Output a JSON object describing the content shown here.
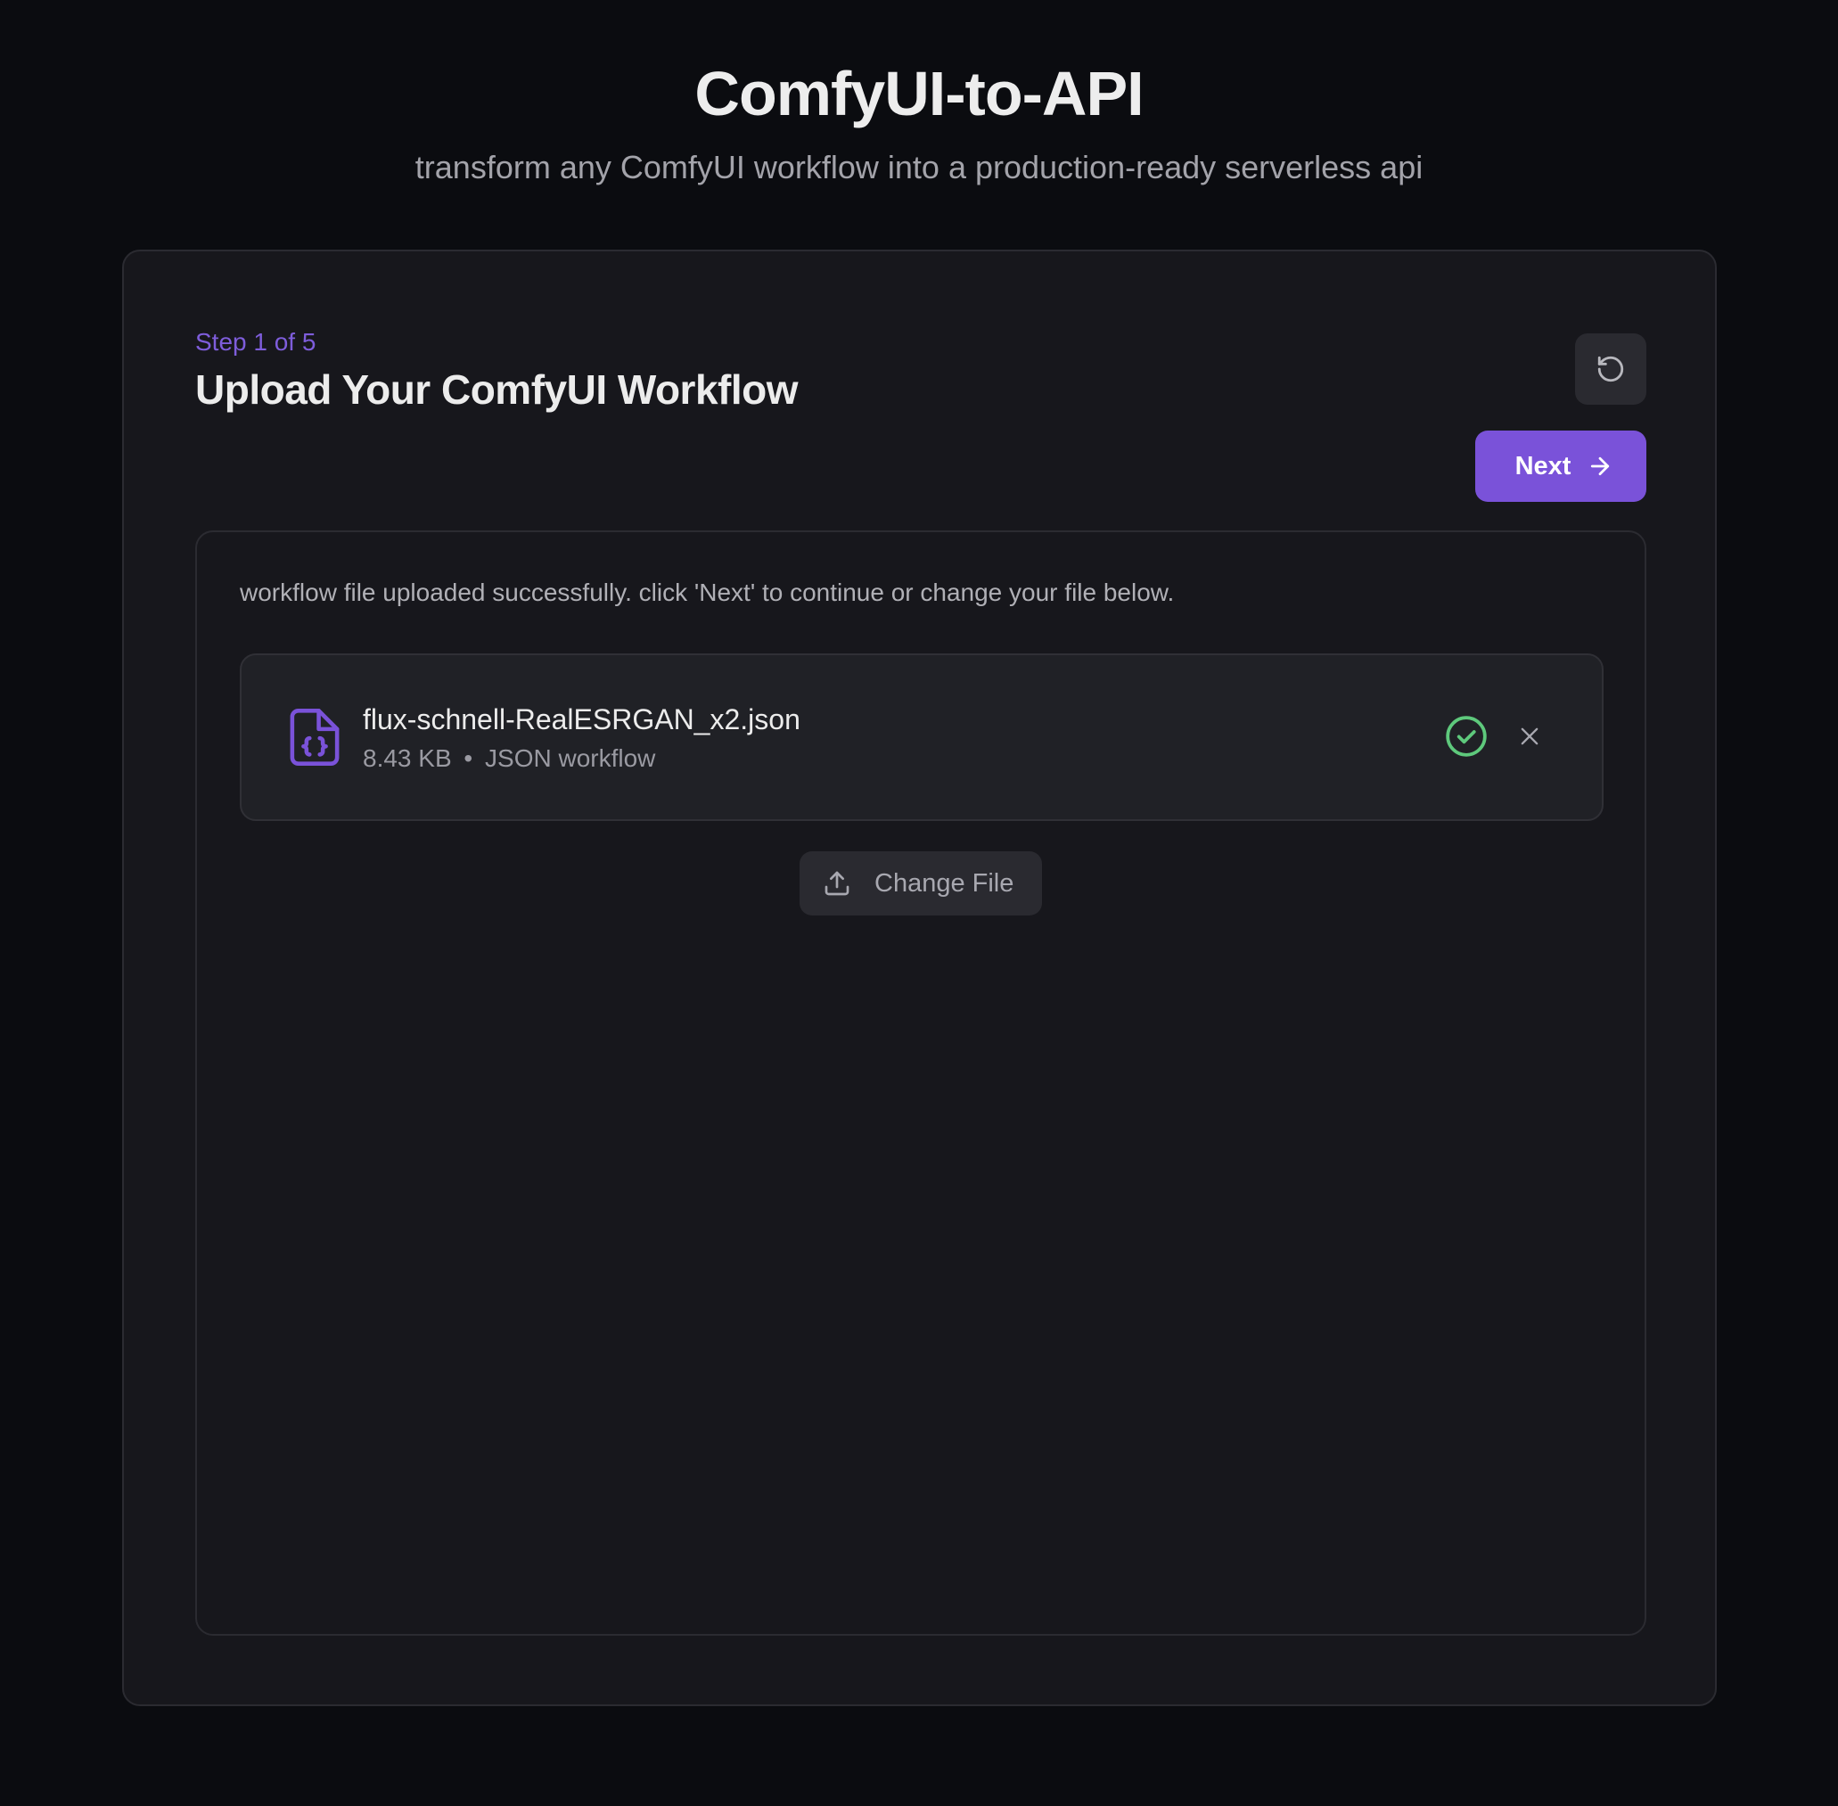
{
  "header": {
    "title": "ComfyUI-to-API",
    "subtitle": "transform any ComfyUI workflow into a production-ready serverless api"
  },
  "step": {
    "label": "Step 1 of 5",
    "current": 1,
    "total": 5,
    "title": "Upload Your ComfyUI Workflow"
  },
  "actions": {
    "reset_icon": "rotate-ccw-icon",
    "next_label": "Next",
    "next_icon": "arrow-right-icon"
  },
  "upload": {
    "status_message": "workflow file uploaded successfully. click 'Next' to continue or change your file below.",
    "file": {
      "icon": "file-json-icon",
      "name": "flux-schnell-RealESRGAN_x2.json",
      "size": "8.43 KB",
      "separator": "•",
      "type": "JSON workflow",
      "status_icon": "check-circle-icon",
      "remove_icon": "close-icon"
    },
    "change_file_label": "Change File",
    "change_file_icon": "upload-icon"
  },
  "colors": {
    "background": "#0b0c10",
    "card": "#17171c",
    "accent": "#7a52d9",
    "accent_text": "#7e5ddb",
    "success": "#5ec97c"
  }
}
